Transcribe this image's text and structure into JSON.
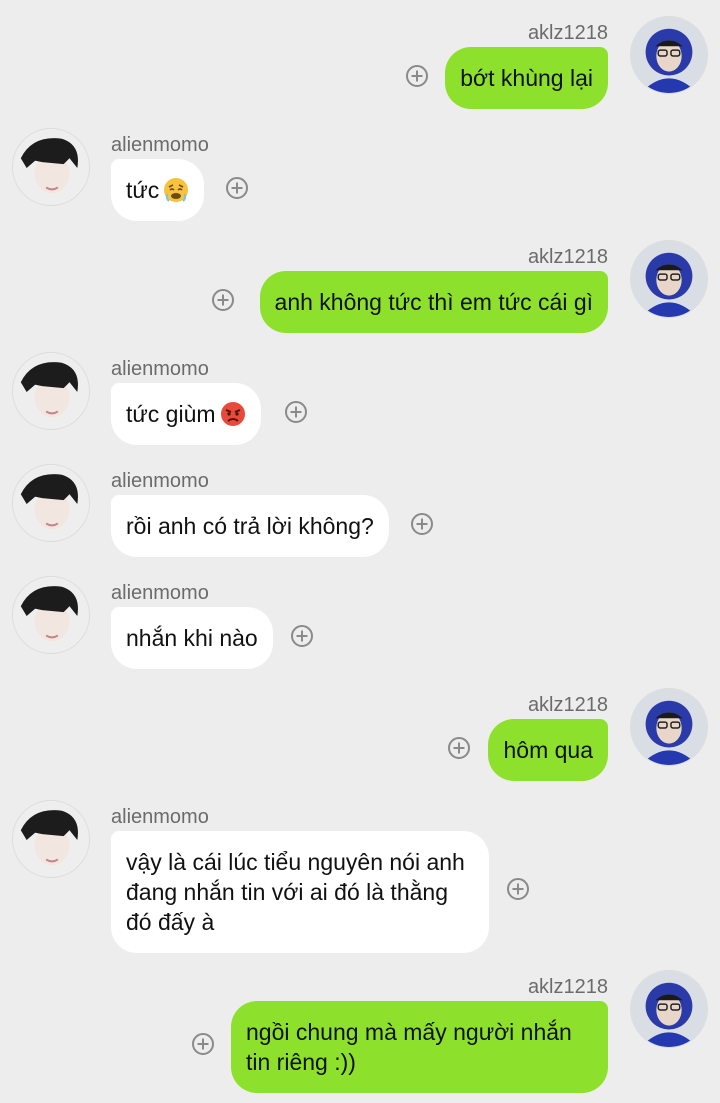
{
  "users": {
    "me": "aklz1218",
    "them": "alienmomo"
  },
  "messages": [
    {
      "from": "me",
      "text": "bớt khùng lại"
    },
    {
      "from": "them",
      "text": "tức",
      "emoji": "tired-face-emoji"
    },
    {
      "from": "me",
      "text": "anh không tức thì em tức cái gì"
    },
    {
      "from": "them",
      "text": "tức giùm",
      "emoji": "angry-face-emoji"
    },
    {
      "from": "them",
      "text": "rồi anh có trả lời không?"
    },
    {
      "from": "them",
      "text": "nhắn khi nào"
    },
    {
      "from": "me",
      "text": "hôm qua"
    },
    {
      "from": "them",
      "text": "vậy là cái lúc tiểu nguyên nói anh đang nhắn tin với ai đó là thằng đó đấy à"
    },
    {
      "from": "me",
      "text": "ngồi chung mà mấy người nhắn tin riêng :))"
    }
  ],
  "colors": {
    "background": "#ededed",
    "outgoing_bubble": "#8de02c",
    "incoming_bubble": "#ffffff"
  }
}
